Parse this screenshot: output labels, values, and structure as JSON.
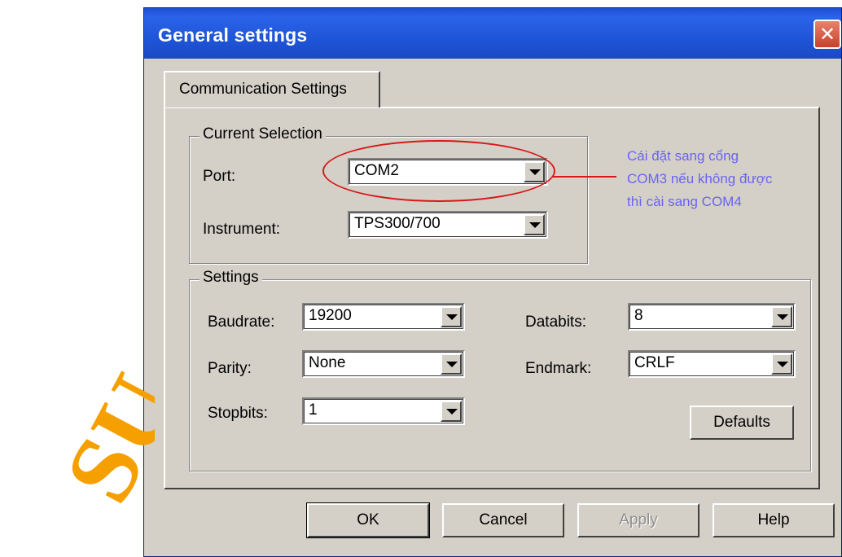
{
  "window": {
    "title": "General settings"
  },
  "tabs": [
    {
      "label": "Communication Settings"
    }
  ],
  "current_selection": {
    "legend": "Current Selection",
    "port_label": "Port:",
    "port_value": "COM2",
    "instrument_label": "Instrument:",
    "instrument_value": "TPS300/700"
  },
  "settings": {
    "legend": "Settings",
    "baudrate_label": "Baudrate:",
    "baudrate_value": "19200",
    "parity_label": "Parity:",
    "parity_value": "None",
    "stopbits_label": "Stopbits:",
    "stopbits_value": "1",
    "databits_label": "Databits:",
    "databits_value": "8",
    "endmark_label": "Endmark:",
    "endmark_value": "CRLF",
    "defaults_label": "Defaults"
  },
  "buttons": {
    "ok": "OK",
    "cancel": "Cancel",
    "apply": "Apply",
    "help": "Help"
  },
  "annotation": {
    "line1": "Cái đặt sang cổng",
    "line2": "COM3 nếu không được",
    "line3": "thì cài sang COM4",
    "text_color": "#6a63f2",
    "mark_color": "#d81818"
  },
  "watermark": {
    "text": "SU",
    "color": "#f5a000"
  },
  "colors": {
    "titlebar": "#2a63e9",
    "dialog_face": "#d4d0c8",
    "close_button": "#c8402a"
  }
}
